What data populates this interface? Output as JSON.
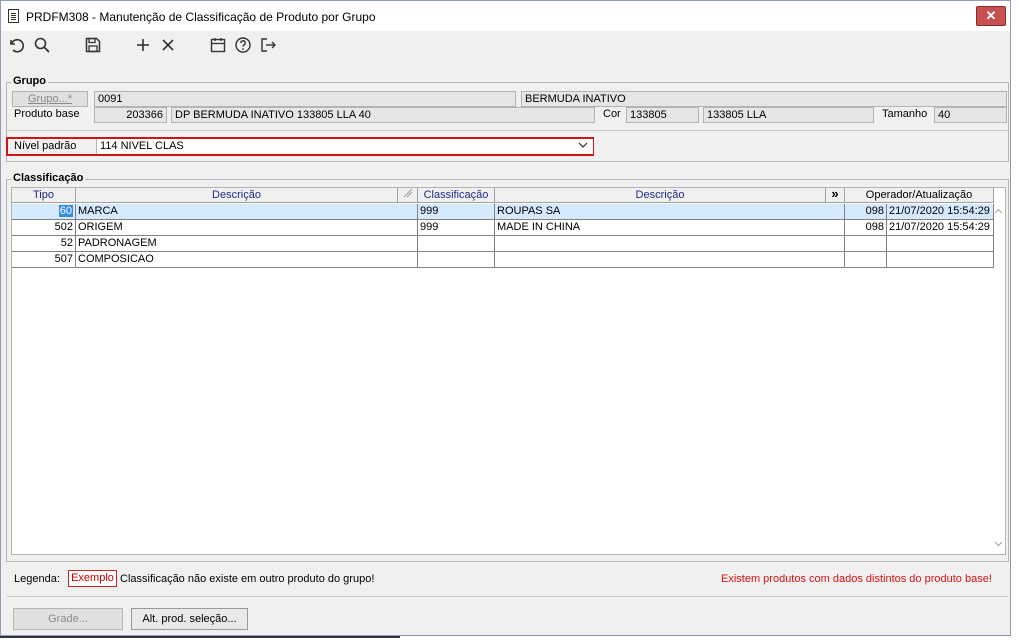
{
  "window": {
    "title": "PRDFM308 - Manutenção de Classificação de Produto por Grupo",
    "close_label": "✕"
  },
  "toolbar": {
    "undo_icon": "undo-icon",
    "search_icon": "search-icon",
    "save_icon": "save-icon",
    "add_icon": "plus-icon",
    "delete_icon": "x-icon",
    "calendar_icon": "calendar-icon",
    "help_icon": "help-icon",
    "exit_icon": "exit-icon"
  },
  "grupo": {
    "legend": "Grupo",
    "grupo_button": "Grupo...*",
    "grupo_code": "0091",
    "grupo_desc": "BERMUDA INATIVO",
    "produto_base_label": "Produto base",
    "produto_base_code": "203366",
    "produto_base_desc": "DP BERMUDA INATIVO 133805 LLA 40",
    "cor_label": "Cor",
    "cor_code": "133805",
    "cor_desc": "133805 LLA",
    "tamanho_label": "Tamanho",
    "tamanho_value": "40"
  },
  "nivel": {
    "label": "Nível padrão",
    "value": "114 NIVEL CLAS"
  },
  "classificacao": {
    "legend": "Classificação",
    "headers": {
      "tipo": "Tipo",
      "descricao": "Descrição",
      "classificacao": "Classificação",
      "descricao2": "Descrição",
      "more": "»",
      "operador": "Operador/Atualização"
    },
    "rows": [
      {
        "tipo": "60",
        "descricao": "MARCA",
        "classificacao": "999",
        "descricao2": "ROUPAS SA",
        "operador": "098",
        "atualizacao": "21/07/2020 15:54:29"
      },
      {
        "tipo": "502",
        "descricao": "ORIGEM",
        "classificacao": "999",
        "descricao2": "MADE IN CHINA",
        "operador": "098",
        "atualizacao": "21/07/2020 15:54:29"
      },
      {
        "tipo": "52",
        "descricao": "PADRONAGEM",
        "classificacao": "",
        "descricao2": "",
        "operador": "",
        "atualizacao": ""
      },
      {
        "tipo": "507",
        "descricao": "COMPOSICAO",
        "classificacao": "",
        "descricao2": "",
        "operador": "",
        "atualizacao": ""
      }
    ]
  },
  "legenda": {
    "label": "Legenda:",
    "exemplo": "Exemplo",
    "text": "Classificação não existe em outro produto do grupo!",
    "warning": "Existem produtos com dados distintos do produto base!"
  },
  "buttons": {
    "grade": "Grade...",
    "alt_prod": "Alt. prod. seleção..."
  },
  "colors": {
    "accent_red": "#d01414",
    "selection": "#3a8ce0",
    "header_text": "#1f2a8c"
  }
}
